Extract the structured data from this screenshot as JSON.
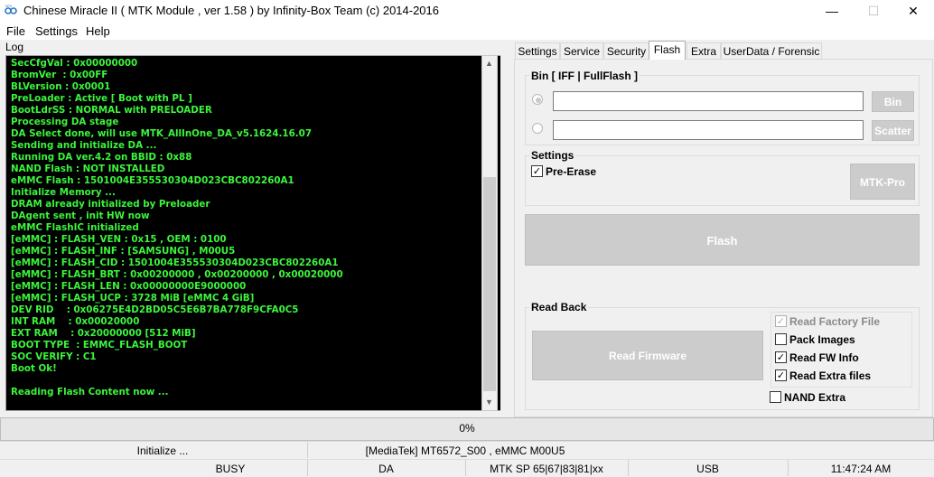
{
  "window": {
    "title": "Chinese Miracle II ( MTK Module , ver 1.58 ) by Infinity-Box Team (c) 2014-2016",
    "minimize": "—",
    "maximize": "☐",
    "close": "✕"
  },
  "menu": [
    "File",
    "Settings",
    "Help"
  ],
  "log": {
    "label": "Log",
    "lines": [
      "SecCfgVal : 0x00000000",
      "BromVer  : 0x00FF",
      "BLVersion : 0x0001",
      "PreLoader : Active [ Boot with PL ]",
      "BootLdrSS : NORMAL with PRELOADER",
      "Processing DA stage",
      "DA Select done, will use MTK_AllInOne_DA_v5.1624.16.07",
      "Sending and initialize DA ...",
      "Running DA ver.4.2 on BBID : 0x88",
      "NAND Flash : NOT INSTALLED",
      "eMMC Flash : 1501004E355530304D023CBC802260A1",
      "Initialize Memory ...",
      "DRAM already initialized by Preloader",
      "DAgent sent , init HW now",
      "eMMC FlashIC initialized",
      "[eMMC] : FLASH_VEN : 0x15 , OEM : 0100",
      "[eMMC] : FLASH_INF : [SAMSUNG] , M00U5",
      "[eMMC] : FLASH_CID : 1501004E355530304D023CBC802260A1",
      "[eMMC] : FLASH_BRT : 0x00200000 , 0x00200000 , 0x00020000",
      "[eMMC] : FLASH_LEN : 0x00000000E9000000",
      "[eMMC] : FLASH_UCP : 3728 MiB [eMMC 4 GiB]",
      "DEV RID    : 0x06275E4D2BD05C5E6B7BA778F9CFA0C5",
      "INT RAM    : 0x00020000",
      "EXT RAM    : 0x20000000 [512 MiB]",
      "BOOT TYPE  : EMMC_FLASH_BOOT",
      "SOC VERIFY : C1",
      "Boot Ok!",
      "",
      "Reading Flash Content now ..."
    ],
    "scroll_up": "▲",
    "scroll_down": "▼"
  },
  "tabs": [
    "Settings",
    "Service",
    "Security",
    "Flash",
    "Extra",
    "UserData / Forensic"
  ],
  "active_tab": "Flash",
  "flash": {
    "bin_group": "Bin  [ IFF | FullFlash ]",
    "bin_path": "",
    "scatter_path": "",
    "bin_button": "Bin",
    "scatter_button": "Scatter",
    "settings_group": "Settings",
    "pre_erase": {
      "label": "Pre-Erase",
      "checked": true
    },
    "mtk_pro_button": "MTK-Pro",
    "flash_button": "Flash",
    "read_back_group": "Read Back",
    "read_firmware_button": "Read Firmware",
    "options": [
      {
        "label": "Read Factory File",
        "checked": true,
        "disabled": true
      },
      {
        "label": "Pack Images",
        "checked": false,
        "disabled": false
      },
      {
        "label": "Read FW Info",
        "checked": true,
        "disabled": false
      },
      {
        "label": "Read Extra files",
        "checked": true,
        "disabled": false
      }
    ],
    "nand_extra": {
      "label": "NAND Extra",
      "checked": false
    }
  },
  "progress": {
    "text": "0%",
    "value": 0
  },
  "status1": {
    "left": "Initialize ...",
    "center": "[MediaTek] MT6572_S00 , eMMC M00U5"
  },
  "status2": [
    "BUSY",
    "DA",
    "MTK SP 65|67|83|81|xx",
    "USB",
    "11:47:24 AM"
  ]
}
